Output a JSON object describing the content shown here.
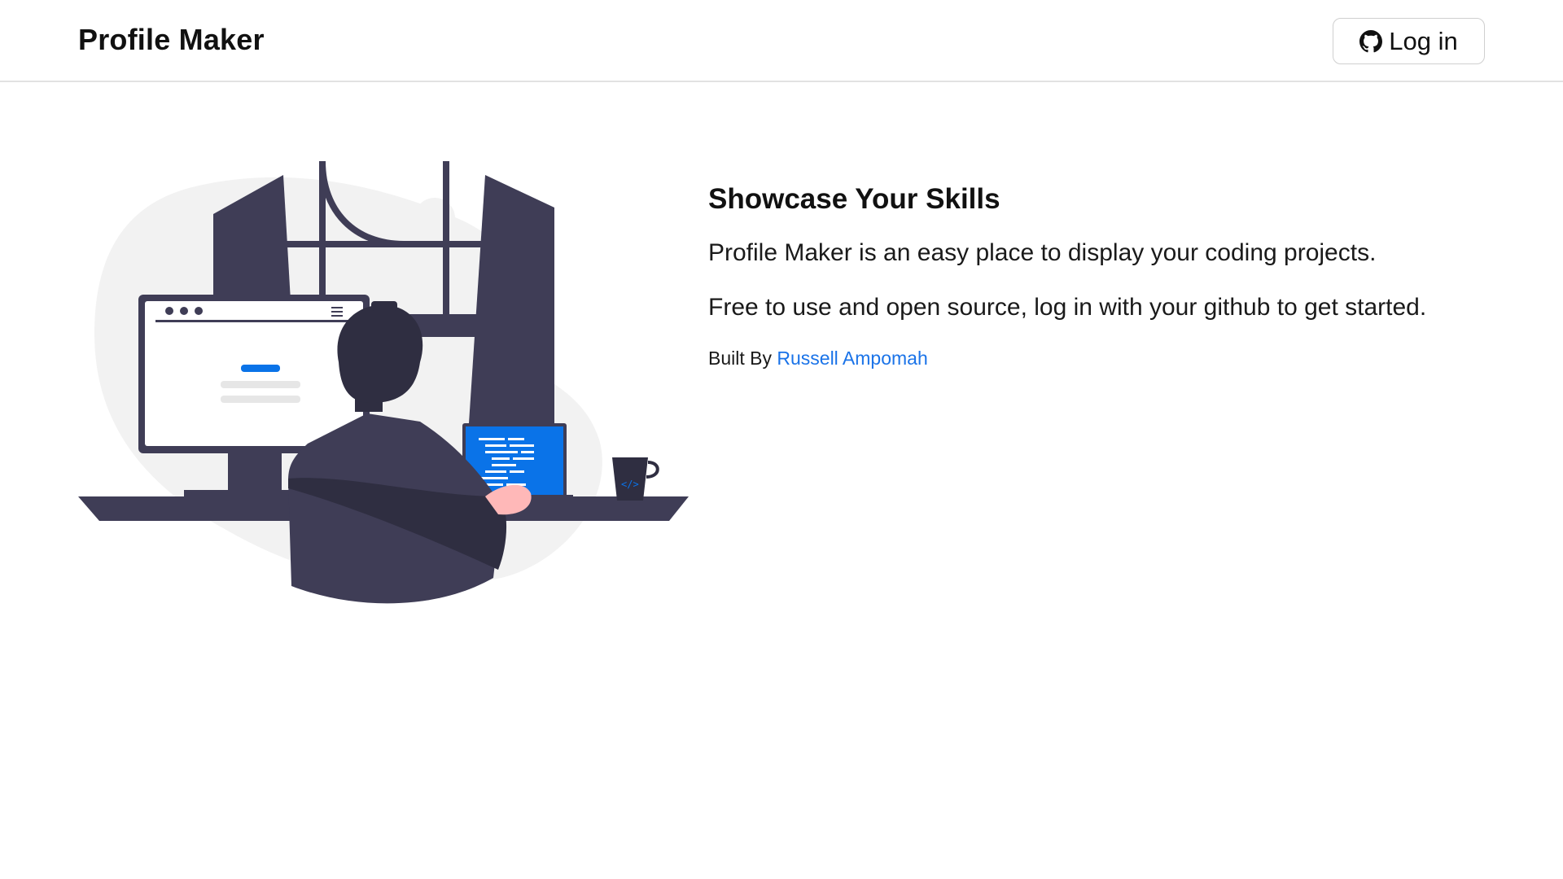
{
  "navbar": {
    "brand": "Profile Maker",
    "login_label": "Log in",
    "login_icon": "github-icon"
  },
  "hero": {
    "illustration": "developer-at-desk-illustration",
    "headline": "Showcase Your Skills",
    "paragraph_1": "Profile Maker is an easy place to display your coding projects.",
    "paragraph_2": "Free to use and open source, log in with your github to get started.",
    "credit_prefix": "Built By",
    "credit_name": "Russell Ampomah"
  },
  "colors": {
    "accent": "#1a73e8",
    "illustration_dark": "#3f3d56",
    "illustration_blue": "#0a73e8",
    "illustration_bg": "#f2f2f2"
  }
}
